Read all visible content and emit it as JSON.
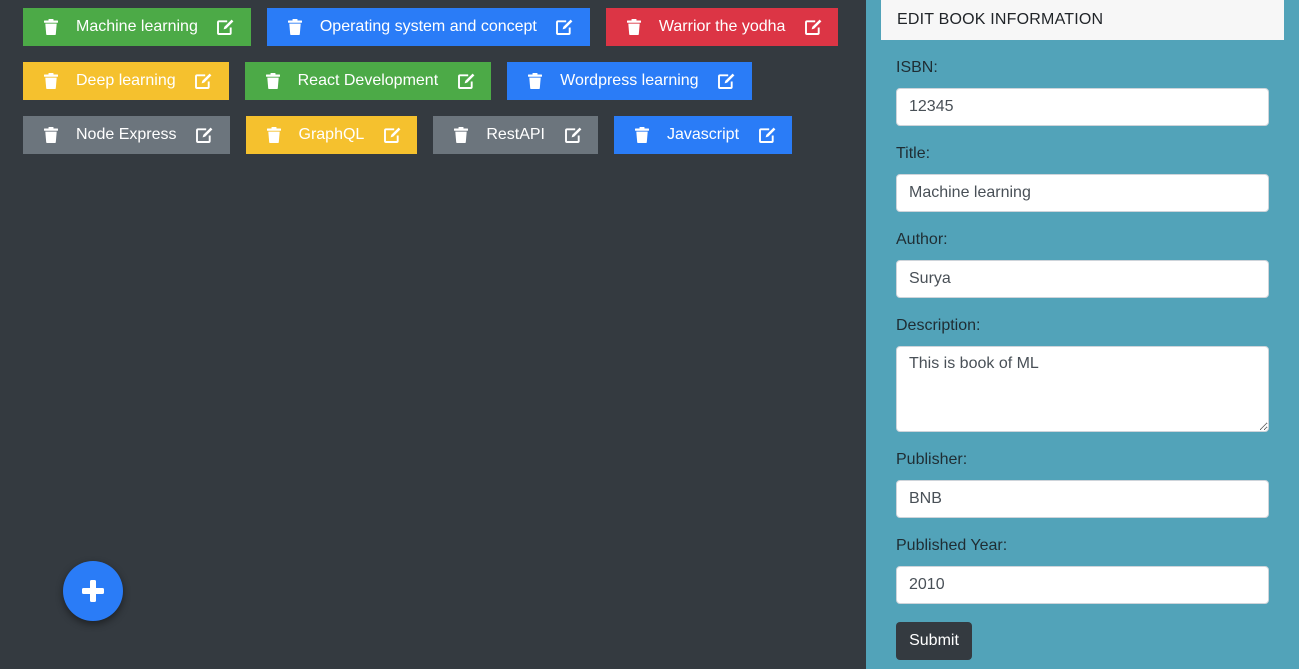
{
  "books": [
    [
      {
        "title": "Machine learning",
        "color": "green"
      },
      {
        "title": "Operating system and concept",
        "color": "blue"
      },
      {
        "title": "Warrior the yodha",
        "color": "red"
      }
    ],
    [
      {
        "title": "Deep learning",
        "color": "yellow"
      },
      {
        "title": "React Development",
        "color": "green"
      },
      {
        "title": "Wordpress learning",
        "color": "blue"
      }
    ],
    [
      {
        "title": "Node Express",
        "color": "gray"
      },
      {
        "title": "GraphQL",
        "color": "yellow"
      },
      {
        "title": "RestAPI",
        "color": "gray"
      },
      {
        "title": "Javascript",
        "color": "blue"
      }
    ]
  ],
  "icons": {
    "delete": "trash-icon",
    "edit": "edit-icon",
    "add": "plus-icon"
  },
  "colors": {
    "green": "#4caa47",
    "blue": "#2a7cf7",
    "red": "#dc3545",
    "yellow": "#f5c12e",
    "gray": "#6c757d",
    "background": "#343a40",
    "sidebar": "#52a3b9"
  },
  "edit_panel": {
    "title": "EDIT BOOK INFORMATION",
    "isbn_label": "ISBN:",
    "isbn_value": "12345",
    "title_label": "Title:",
    "title_value": "Machine learning",
    "author_label": "Author:",
    "author_value": "Surya",
    "description_label": "Description:",
    "description_value": "This is book of ML",
    "publisher_label": "Publisher:",
    "publisher_value": "BNB",
    "year_label": "Published Year:",
    "year_value": "2010",
    "submit_label": "Submit"
  }
}
